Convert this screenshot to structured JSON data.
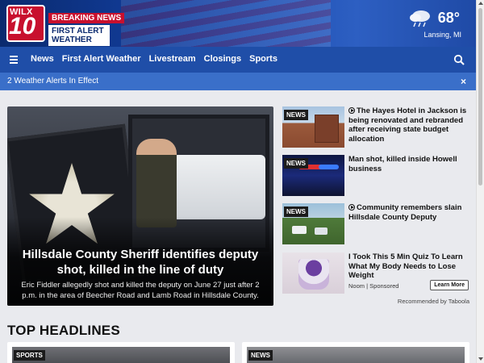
{
  "header": {
    "logo_wilx": "WILX",
    "logo_number": "10",
    "tag_breaking": "BREAKING NEWS",
    "tag_alert": "FIRST ALERT WEATHER",
    "weather": {
      "temp": "68°",
      "location": "Lansing, MI",
      "icon": "cloud-rain-icon"
    }
  },
  "nav": {
    "items": [
      {
        "label": "News"
      },
      {
        "label": "First Alert Weather"
      },
      {
        "label": "Livestream"
      },
      {
        "label": "Closings"
      },
      {
        "label": "Sports"
      }
    ]
  },
  "alerts": {
    "text": "2 Weather Alerts In Effect",
    "close": "×"
  },
  "hero": {
    "title": "Hillsdale County Sheriff identifies deputy shot, killed in the line of duty",
    "description": "Eric Fiddler allegedly shot and killed the deputy on June 27 just after 2 p.m. in the area of Beecher Road and Lamb Road in Hillsdale County."
  },
  "stories": [
    {
      "tag": "NEWS",
      "title": "The Hayes Hotel in Jackson is being renovated and rebranded after receiving state budget allocation",
      "video": true
    },
    {
      "tag": "NEWS",
      "title": "Man shot, killed inside Howell business",
      "video": false
    },
    {
      "tag": "NEWS",
      "title": "Community remembers slain Hillsdale County Deputy",
      "video": true
    },
    {
      "tag": "",
      "title": "I Took This 5 Min Quiz To Learn What My Body Needs to Lose Weight",
      "video": false,
      "source": "Noom",
      "sponsored": "Sponsored",
      "cta": "Learn More"
    }
  ],
  "taboola": "Recommended by Taboola",
  "top_headlines": {
    "title": "TOP HEADLINES",
    "cards": [
      {
        "tag": "SPORTS"
      },
      {
        "tag": "NEWS"
      }
    ]
  },
  "colors": {
    "brand_blue": "#1f4ea8",
    "brand_red": "#c8102e",
    "alert_blue": "#3a6fc9"
  }
}
